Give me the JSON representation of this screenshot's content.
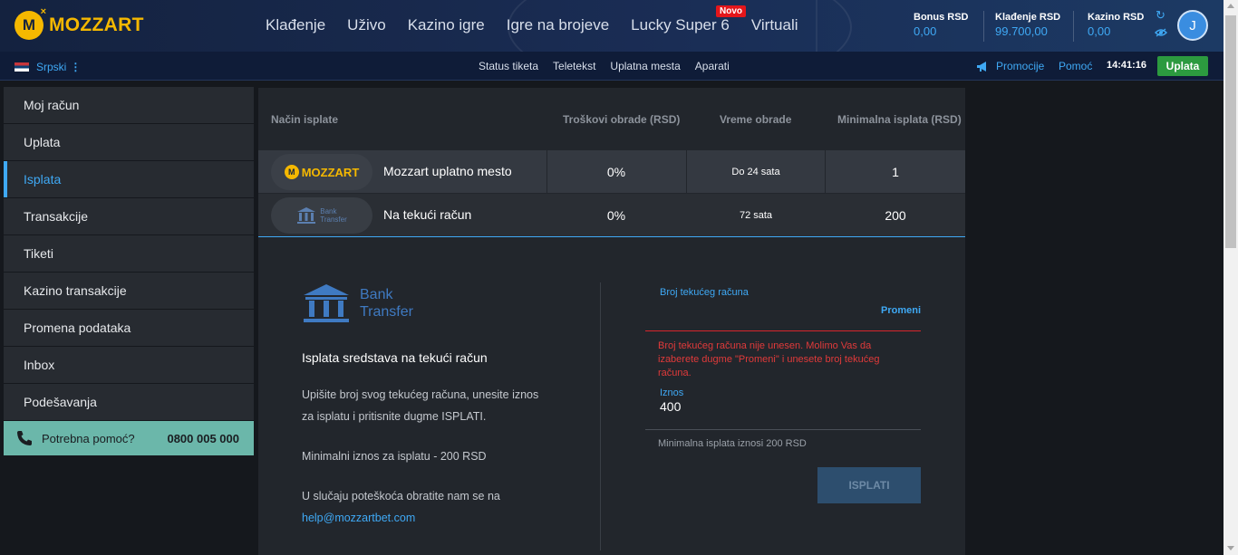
{
  "brand": {
    "logo_text": "MOZZART",
    "logo_mark": "M",
    "color": "#f5b800"
  },
  "nav": {
    "items": [
      "Klađenje",
      "Uživo",
      "Kazino igre",
      "Igre na brojeve",
      "Lucky Super 6",
      "Virtuali"
    ],
    "new_badge": "Novo"
  },
  "balances": [
    {
      "label": "Bonus RSD",
      "value": "0,00"
    },
    {
      "label": "Klađenje RSD",
      "value": "99.700,00"
    },
    {
      "label": "Kazino RSD",
      "value": "0,00"
    }
  ],
  "user": {
    "avatar_letter": "J"
  },
  "subbar": {
    "language": "Srpski",
    "links": [
      "Status tiketa",
      "Teletekst",
      "Uplatna mesta",
      "Aparati"
    ],
    "promo": "Promocije",
    "help": "Pomoć",
    "time": "14:41:16",
    "deposit_button": "Uplata"
  },
  "sidebar": {
    "items": [
      "Moj račun",
      "Uplata",
      "Isplata",
      "Transakcije",
      "Tiketi",
      "Kazino transakcije",
      "Promena podataka",
      "Inbox",
      "Podešavanja"
    ],
    "active": "Isplata",
    "help_label": "Potrebna pomoć?",
    "help_phone": "0800 005 000"
  },
  "table": {
    "headers": [
      "Način isplate",
      "Troškovi obrade (RSD)",
      "Vreme obrade",
      "Minimalna isplata (RSD)"
    ],
    "rows": [
      {
        "logo": "MOZZART",
        "name": "Mozzart uplatno mesto",
        "fee": "0%",
        "time": "Do 24 sata",
        "min": "1"
      },
      {
        "logo_line1": "Bank",
        "logo_line2": "Transfer",
        "name": "Na tekući račun",
        "fee": "0%",
        "time": "72 sata",
        "min": "200"
      }
    ]
  },
  "details": {
    "logo_line1": "Bank",
    "logo_line2": "Transfer",
    "title": "Isplata sredstava na tekući račun",
    "instructions_line1": "Upišite broj svog tekućeg računa, unesite iznos",
    "instructions_line2": "za isplatu i pritisnite dugme ISPLATI.",
    "minimum": "Minimalni iznos za isplatu - 200 RSD",
    "contact_line": "U slučaju poteškoća obratite nam se na",
    "email": "help@mozzartbet.com"
  },
  "form": {
    "account_label": "Broj tekućeg računa",
    "change_link": "Promeni",
    "error": "Broj tekućeg računa nije unesen. Molimo Vas da izaberete dugme \"Promeni\" i unesete broj tekućeg računa.",
    "amount_label": "Iznos",
    "amount_value": "400",
    "min_note": "Minimalna isplata iznosi 200 RSD",
    "submit": "ISPLATI"
  }
}
